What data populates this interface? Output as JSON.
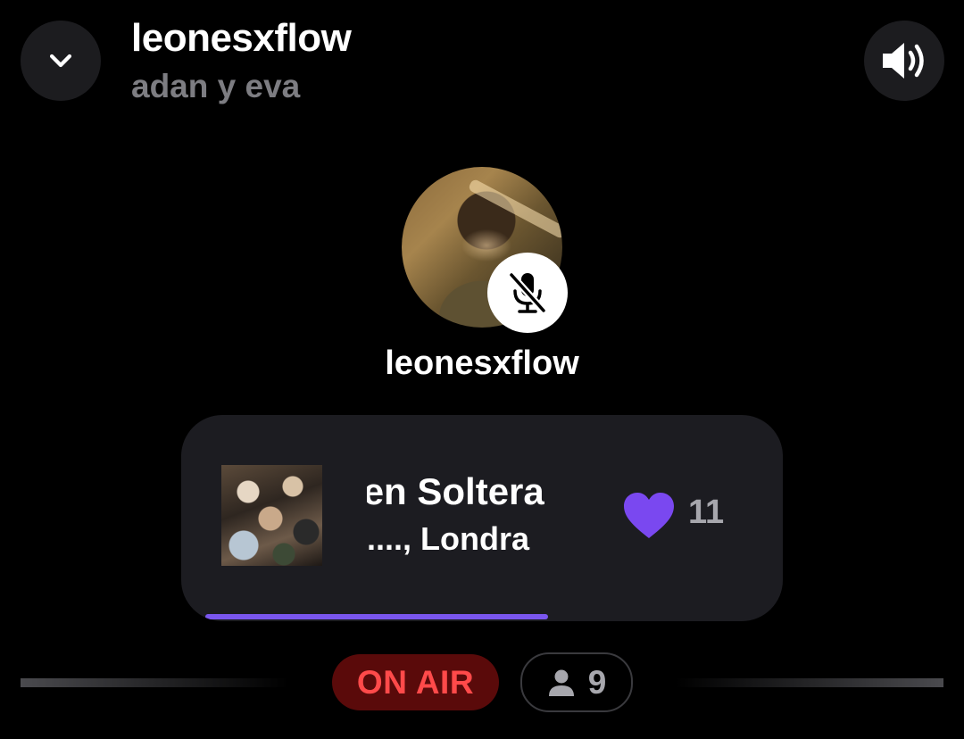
{
  "header": {
    "title": "leonesxflow",
    "subtitle": "adan y eva",
    "collapse_icon": "chevron-down-icon",
    "sound_icon": "speaker-volume-icon"
  },
  "host": {
    "name": "leonesxflow",
    "mic_status": "muted",
    "mic_icon": "mic-off-icon"
  },
  "now_playing": {
    "title": "Ven Soltera",
    "artist": "...., Londra",
    "likes": "11",
    "like_icon": "heart-icon",
    "progress": 0.62
  },
  "status": {
    "on_air": "ON AIR",
    "listeners": "9",
    "listeners_icon": "person-icon"
  },
  "colors": {
    "background": "#000000",
    "card": "#1c1c21",
    "accent": "#7a56ee",
    "on_air_bg": "#5a0a0a",
    "on_air_text": "#ff4a4a",
    "muted_text": "#7d7d82"
  }
}
